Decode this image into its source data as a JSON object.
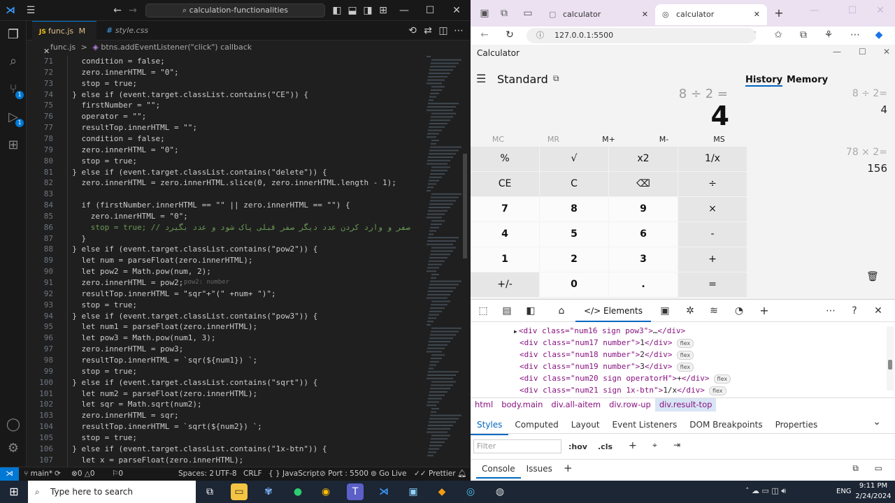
{
  "vscode": {
    "search": "calculation-functionalities",
    "tabs": [
      {
        "name": "func.js",
        "modified": "M"
      },
      {
        "name": "style.css"
      }
    ],
    "breadcrumb": {
      "file": "func.js",
      "sep": ">",
      "symbol": "btns.addEventListener(\"click\") callback"
    },
    "lines": [
      {
        "n": "71",
        "code": "    condition = false;"
      },
      {
        "n": "72",
        "code": "    zero.innerHTML = \"0\";"
      },
      {
        "n": "73",
        "code": "    stop = true;"
      },
      {
        "n": "74",
        "code": "  } else if (event.target.classList.contains(\"CE\")) {"
      },
      {
        "n": "75",
        "code": "    firstNumber = \"\";"
      },
      {
        "n": "76",
        "code": "    operator = \"\";"
      },
      {
        "n": "77",
        "code": "    resultTop.innerHTML = \"\";"
      },
      {
        "n": "78",
        "code": "    condition = false;"
      },
      {
        "n": "79",
        "code": "    zero.innerHTML = \"0\";"
      },
      {
        "n": "80",
        "code": "    stop = true;"
      },
      {
        "n": "81",
        "code": "  } else if (event.target.classList.contains(\"delete\")) {"
      },
      {
        "n": "82",
        "code": "    zero.innerHTML = zero.innerHTML.slice(0, zero.innerHTML.length - 1);"
      },
      {
        "n": "83",
        "code": ""
      },
      {
        "n": "84",
        "code": "    if (firstNumber.innerHTML == \"\" || zero.innerHTML == \"\") {"
      },
      {
        "n": "85",
        "code": "      zero.innerHTML = \"0\";"
      },
      {
        "n": "86",
        "code": "      stop = true; // صفر و وارد کردن عدد دیگر صفر قبلی پاک شود و عدد بگیرد"
      },
      {
        "n": "87",
        "code": "    }"
      },
      {
        "n": "88",
        "code": "  } else if (event.target.classList.contains(\"pow2\")) {"
      },
      {
        "n": "89",
        "code": "    let num = parseFloat(zero.innerHTML);"
      },
      {
        "n": "90",
        "code": "    let pow2 = Math.pow(num, 2);"
      },
      {
        "n": "91",
        "code": "    zero.innerHTML = pow2;"
      },
      {
        "n": "92",
        "code": "    resultTop.innerHTML = \"sqr\"+\"(\" +num+ \")\";"
      },
      {
        "n": "93",
        "code": "    stop = true;"
      },
      {
        "n": "94",
        "code": "  } else if (event.target.classList.contains(\"pow3\")) {"
      },
      {
        "n": "95",
        "code": "    let num1 = parseFloat(zero.innerHTML);"
      },
      {
        "n": "96",
        "code": "    let pow3 = Math.pow(num1, 3);"
      },
      {
        "n": "97",
        "code": "    zero.innerHTML = pow3;"
      },
      {
        "n": "98",
        "code": "    resultTop.innerHTML = `sqr(${num1}) `;"
      },
      {
        "n": "99",
        "code": "    stop = true;"
      },
      {
        "n": "100",
        "code": "  } else if (event.target.classList.contains(\"sqrt\")) {"
      },
      {
        "n": "101",
        "code": "    let num2 = parseFloat(zero.innerHTML);"
      },
      {
        "n": "102",
        "code": "    let sqr = Math.sqrt(num2);"
      },
      {
        "n": "103",
        "code": "    zero.innerHTML = sqr;"
      },
      {
        "n": "104",
        "code": "    resultTop.innerHTML = `sqrt(${num2}) `;"
      },
      {
        "n": "105",
        "code": "    stop = true;"
      },
      {
        "n": "106",
        "code": "  } else if (event.target.classList.contains(\"1x-btn\")) {"
      },
      {
        "n": "107",
        "code": "    let x = parseFloat(zero.innerHTML);"
      }
    ],
    "inlay_hint": "pow2: number",
    "status": {
      "branch": "main*",
      "errors": "0",
      "warnings": "0",
      "info": "0",
      "spaces": "Spaces: 2",
      "encoding": "UTF-8",
      "eol": "CRLF",
      "language": "JavaScript",
      "port": "Port : 5500",
      "golive": "Go Live",
      "prettier": "Prettier"
    }
  },
  "edge": {
    "tabs": [
      {
        "title": "calculator"
      },
      {
        "title": "calculator"
      }
    ],
    "url": "127.0.0.1:5500",
    "app_title": "Calculator",
    "mode": "Standard",
    "expression": "8 ÷ 2 =",
    "result": "4",
    "memory_buttons": [
      "MC",
      "MR",
      "M+",
      "M-",
      "MS"
    ],
    "keypad": [
      [
        "%",
        "√",
        "x2",
        "1/x"
      ],
      [
        "CE",
        "C",
        "⌫",
        "÷"
      ],
      [
        "7",
        "8",
        "9",
        "×"
      ],
      [
        "4",
        "5",
        "6",
        "-"
      ],
      [
        "1",
        "2",
        "3",
        "+"
      ],
      [
        "+/-",
        "0",
        ".",
        "="
      ]
    ],
    "panel_tabs": [
      "History",
      "Memory"
    ],
    "history": [
      {
        "expr": "8 ÷ 2=",
        "value": "4"
      },
      {
        "expr": "78 × 2=",
        "value": "156"
      }
    ],
    "devtools": {
      "tool_tab": "Elements",
      "dom": [
        {
          "open": "<div class=\"num16 sign pow3\">",
          "inner": "…",
          "close": "</div>",
          "flex": ""
        },
        {
          "open": "<div class=\"num17 number\">",
          "inner": "1",
          "close": "</div>",
          "flex": "flex"
        },
        {
          "open": "<div class=\"num18 number\">",
          "inner": "2",
          "close": "</div>",
          "flex": "flex"
        },
        {
          "open": "<div class=\"num19 number\">",
          "inner": "3",
          "close": "</div>",
          "flex": "flex"
        },
        {
          "open": "<div class=\"num20 sign operatorH\">",
          "inner": "+",
          "close": "</div>",
          "flex": "flex"
        },
        {
          "open": "<div class=\"num21 sign 1x-btn\">",
          "inner": "1/x",
          "close": "</div>",
          "flex": "flex"
        }
      ],
      "crumbs": [
        "html",
        "body.main",
        "div.all-aitem",
        "div.row-up",
        "div.result-top"
      ],
      "panes": [
        "Styles",
        "Computed",
        "Layout",
        "Event Listeners",
        "DOM Breakpoints",
        "Properties"
      ],
      "filter_placeholder": "Filter",
      "hov": ":hov",
      "cls": ".cls",
      "drawer_tabs": [
        "Console",
        "Issues"
      ]
    }
  },
  "taskbar": {
    "search_placeholder": "Type here to search",
    "lang": "ENG",
    "time": "9:11 PM",
    "date": "2/24/2024"
  }
}
